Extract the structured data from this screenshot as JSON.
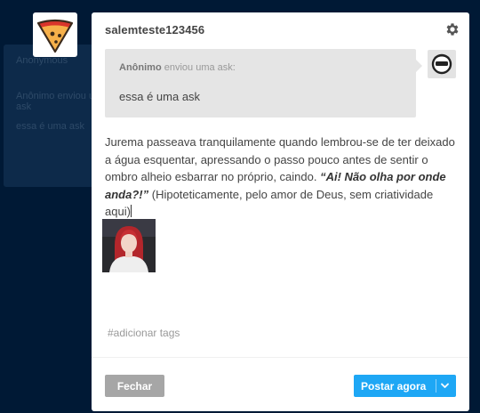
{
  "background": {
    "panel_title": "Anonymous",
    "rows": [
      "Anônimo enviou uma ask",
      "essa é uma ask"
    ]
  },
  "post": {
    "blog_name": "salemteste123456",
    "ask": {
      "asker": "Anônimo",
      "meta_suffix": " enviou uma ask:",
      "question": "essa é uma ask"
    },
    "answer": {
      "text_part1": "Jurema passeava tranquilamente quando lembrou-se de ter deixado a água esquentar, apressando o passo pouco antes de sentir o ombro alheio esbarrar no próprio, caindo. ",
      "emphasis": "“Ai! Não olha por onde anda?!”",
      "text_part2": " (Hipoteticamente, pelo amor de Deus, sem criatividade aqui)"
    },
    "tags_placeholder": "#adicionar tags"
  },
  "footer": {
    "close_label": "Fechar",
    "post_label": "Postar agora"
  },
  "colors": {
    "page_bg": "#001935",
    "accent": "#1ea7f5",
    "close_button": "#a6a6a6",
    "ask_bg": "#e5e5e5"
  },
  "icons": {
    "settings": "gear-icon",
    "dropdown": "chevron-down-icon",
    "blog_avatar": "pizza-slice-avatar",
    "asker_avatar": "anonymous-sunglasses-avatar"
  }
}
